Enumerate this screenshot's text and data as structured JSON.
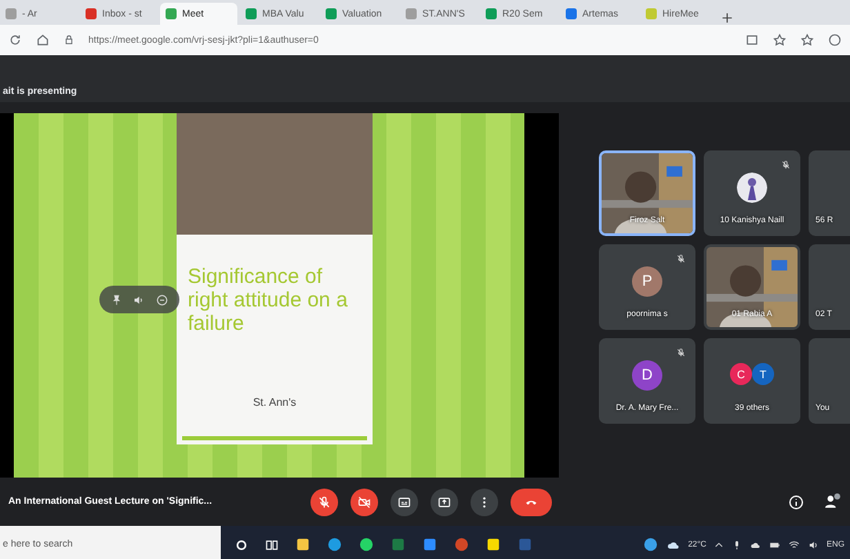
{
  "browser": {
    "tabs": [
      {
        "label": "- Ar",
        "selected": false,
        "color": "#9e9e9e"
      },
      {
        "label": "Inbox - st",
        "selected": false,
        "color": "#d93025"
      },
      {
        "label": "Meet",
        "selected": true,
        "color": "#34a853"
      },
      {
        "label": "MBA Valu",
        "selected": false,
        "color": "#0f9d58"
      },
      {
        "label": "Valuation",
        "selected": false,
        "color": "#0f9d58"
      },
      {
        "label": "ST.ANN'S",
        "selected": false,
        "color": "#9e9e9e"
      },
      {
        "label": "R20 Sem",
        "selected": false,
        "color": "#0f9d58"
      },
      {
        "label": "Artemas",
        "selected": false,
        "color": "#1a73e8"
      },
      {
        "label": "HireMee",
        "selected": false,
        "color": "#c0ca33"
      }
    ],
    "url": "https://meet.google.com/vrj-sesj-jkt?pli=1&authuser=0"
  },
  "meet": {
    "banner": "ait is presenting",
    "slide": {
      "title": "Significance of right attitude on a failure",
      "subtitle": "St. Ann's"
    },
    "tiles": [
      {
        "kind": "video",
        "name": "Firoz Salt",
        "selected": true,
        "muted": false
      },
      {
        "kind": "photo_avatar",
        "name": "10 Kanishya Naill",
        "selected": false,
        "muted": true
      },
      {
        "kind": "cut",
        "name": "56 R",
        "selected": false,
        "muted": false
      },
      {
        "kind": "letter",
        "name": "poornima s",
        "initial": "P",
        "color": "#a1786a",
        "selected": false,
        "muted": true
      },
      {
        "kind": "video",
        "name": "01 Rabia A",
        "selected": false,
        "muted": false
      },
      {
        "kind": "cut",
        "name": "02 T",
        "selected": false,
        "muted": false
      },
      {
        "kind": "letter",
        "name": "Dr. A. Mary Fre...",
        "initial": "D",
        "color": "#8e44c8",
        "selected": false,
        "muted": true
      },
      {
        "kind": "others",
        "name": "39 others",
        "avatars": [
          {
            "initial": "C",
            "color": "#e8285a"
          },
          {
            "initial": "T",
            "color": "#1565c0"
          }
        ],
        "selected": false,
        "muted": false
      },
      {
        "kind": "cut",
        "name": "You",
        "selected": false,
        "muted": false
      }
    ],
    "meeting_title": "An International Guest Lecture on 'Signific...",
    "controls": [
      {
        "kind": "mic_off"
      },
      {
        "kind": "cam_off"
      },
      {
        "kind": "captions"
      },
      {
        "kind": "present"
      },
      {
        "kind": "more"
      },
      {
        "kind": "hangup"
      }
    ]
  },
  "taskbar": {
    "search_placeholder": "e here to search",
    "temperature": "22°C",
    "language": "ENG"
  }
}
